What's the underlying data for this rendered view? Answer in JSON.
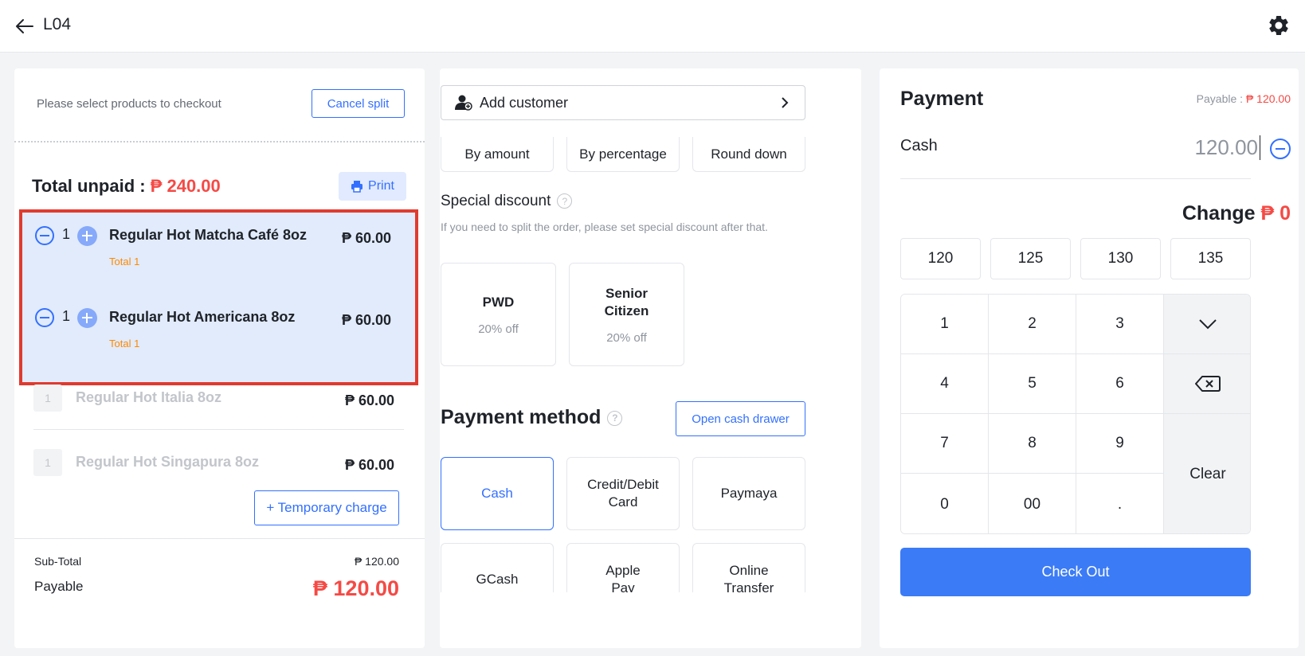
{
  "header": {
    "title": "L04",
    "back_icon": "arrow-left-icon",
    "settings_icon": "gear-icon"
  },
  "cart": {
    "hint": "Please select products to checkout",
    "cancel_split": "Cancel split",
    "total_unpaid_label": "Total unpaid : ",
    "total_unpaid_value": "₱ 240.00",
    "print_label": "Print",
    "selected_items": [
      {
        "qty": "1",
        "name": "Regular Hot Matcha Café 8oz",
        "sub": "Total 1",
        "price": "₱ 60.00"
      },
      {
        "qty": "1",
        "name": "Regular Hot Americana 8oz",
        "sub": "Total 1",
        "price": "₱ 60.00"
      }
    ],
    "other_items": [
      {
        "qty": "1",
        "name": "Regular Hot Italia 8oz",
        "price": "₱ 60.00"
      },
      {
        "qty": "1",
        "name": "Regular Hot Singapura 8oz",
        "price": "₱ 60.00"
      }
    ],
    "temporary_charge": "+ Temporary charge",
    "subtotal_label": "Sub-Total",
    "subtotal_value": "₱ 120.00",
    "payable_label": "Payable",
    "payable_value": "₱ 120.00"
  },
  "discount": {
    "add_customer": "Add customer",
    "types": [
      "By amount",
      "By percentage",
      "Round down"
    ],
    "special_title": "Special discount",
    "special_note": "If you need to split the order, please set special discount after that.",
    "special_cards": [
      {
        "name": "PWD",
        "off": "20% off"
      },
      {
        "name": "Senior Citizen",
        "off": "20% off"
      }
    ],
    "payment_method_title": "Payment method",
    "open_cash_drawer": "Open cash drawer",
    "methods": [
      "Cash",
      "Credit/Debit Card",
      "Paymaya",
      "GCash",
      "Apple Pay",
      "Online Transfer"
    ],
    "active_method": "Cash"
  },
  "payment": {
    "title": "Payment",
    "payable_label": "Payable : ",
    "payable_value": "₱ 120.00",
    "cash_label": "Cash",
    "cash_value": "120.00",
    "change_label": "Change ",
    "change_value": "₱ 0",
    "quick_amounts": [
      "120",
      "125",
      "130",
      "135"
    ],
    "keys": [
      "1",
      "2",
      "3",
      "4",
      "5",
      "6",
      "7",
      "8",
      "9",
      "0",
      "00",
      "."
    ],
    "clear_label": "Clear",
    "checkout_label": "Check Out"
  },
  "colors": {
    "accent": "#3370ff",
    "price_red": "#f54a45",
    "sub_orange": "#ff8800",
    "highlight_border": "#e03a2f",
    "selected_bg": "#e1ebfc"
  }
}
